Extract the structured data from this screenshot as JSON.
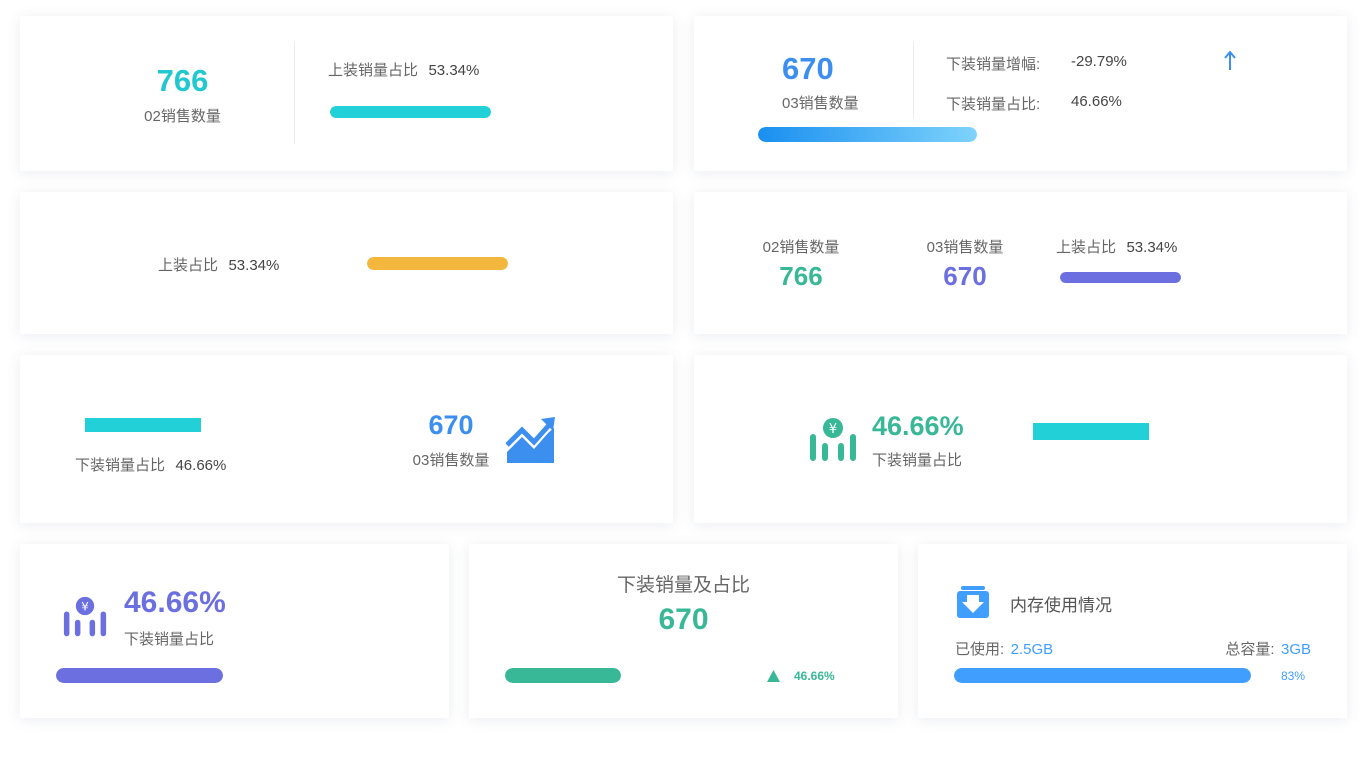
{
  "card1": {
    "count": "766",
    "count_label": "02销售数量",
    "ratio_label": "上装销量占比",
    "ratio_value": "53.34%",
    "bar_color": "#22d1d8"
  },
  "card2": {
    "count": "670",
    "count_label": "03销售数量",
    "growth_label": "下装销量增幅:",
    "growth_value": "-29.79%",
    "ratio_label": "下装销量占比:",
    "ratio_value": "46.66%",
    "arrow_icon": "arrow-up-icon",
    "bar_colors": [
      "#1a8ff0",
      "#7ed3fb"
    ]
  },
  "card3": {
    "ratio_label": "上装占比",
    "ratio_value": "53.34%",
    "bar_color": "#f3b73e"
  },
  "card4": {
    "count_a_label": "02销售数量",
    "count_a": "766",
    "count_a_color": "#39b897",
    "count_b_label": "03销售数量",
    "count_b": "670",
    "count_b_color": "#6c6fe0",
    "ratio_label": "上装占比",
    "ratio_value": "53.34%",
    "bar_color": "#6c6fe0"
  },
  "card5": {
    "ratio_label": "下装销量占比",
    "ratio_value": "46.66%",
    "count": "670",
    "count_label": "03销售数量",
    "icon": "trend-chart-icon",
    "bar_color": "#22d1d8",
    "accent": "#3d8fef"
  },
  "card6": {
    "percent": "46.66%",
    "label": "下装销量占比",
    "icon": "money-chart-icon",
    "accent": "#39b897",
    "bar_color": "#22d1d8"
  },
  "card7": {
    "percent": "46.66%",
    "label": "下装销量占比",
    "icon": "money-chart-icon",
    "accent": "#6c6fe0"
  },
  "card8": {
    "title": "下装销量及占比",
    "count": "670",
    "percent": "46.66%",
    "up_icon": "triangle-up-icon",
    "accent": "#39b897"
  },
  "card9": {
    "title": "内存使用情况",
    "icon": "download-box-icon",
    "used_label": "已使用:",
    "used_value": "2.5GB",
    "total_label": "总容量:",
    "total_value": "3GB",
    "percent": "83%",
    "progress": 0.83,
    "accent": "#409eff"
  }
}
